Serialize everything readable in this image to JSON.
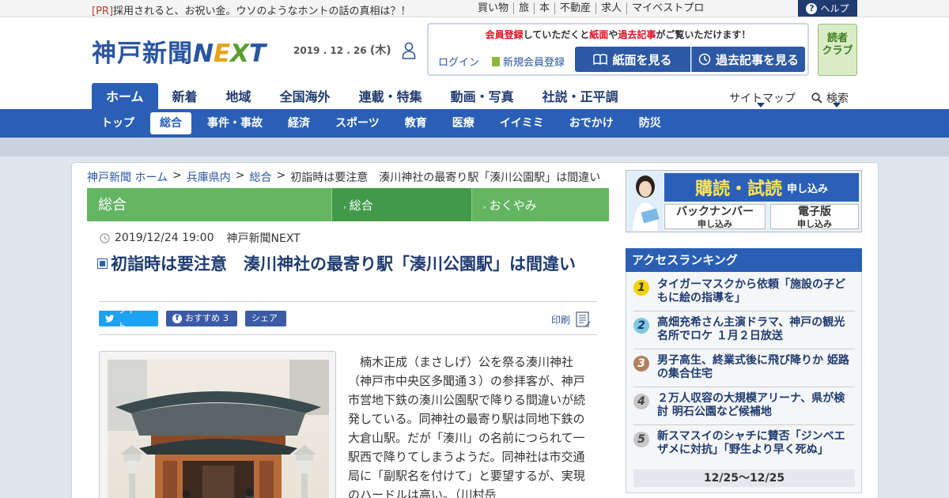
{
  "top": {
    "pr_tag": "[PR]",
    "pr_text": "採用されると、お祝い金。ウソのようなホントの話の真相は？！",
    "links": [
      "買い物",
      "旅",
      "本",
      "不動産",
      "求人",
      "マイベストプロ"
    ],
    "help": "ヘルプ"
  },
  "header": {
    "logo_text": "神戸新聞",
    "logo_next": [
      "N",
      "E",
      "X",
      "T"
    ],
    "date": "2019 . 12 . 26",
    "weekday": "(木)",
    "member_text_parts": [
      "会員登録",
      "していただくと",
      "紙面",
      "や",
      "過去記事",
      "がご覧いただけます！"
    ],
    "login": "ログイン",
    "register": "新規会員登録",
    "paper_button": "紙面を見る",
    "past_button": "過去記事を見る",
    "readers_club": [
      "読者",
      "クラブ"
    ]
  },
  "nav": {
    "main": [
      "ホーム",
      "新着",
      "地域",
      "全国海外",
      "連載・特集",
      "動画・写真",
      "社説・正平調"
    ],
    "sitemap": "サイトマップ",
    "search": "検索",
    "sub": [
      "トップ",
      "総合",
      "事件・事故",
      "経済",
      "スポーツ",
      "教育",
      "医療",
      "イイミミ",
      "おでかけ",
      "防災"
    ]
  },
  "breadcrumb": [
    "神戸新聞 ホーム",
    "兵庫県内",
    "総合",
    "初詣時は要注意　湊川神社の最寄り駅「湊川公園駅」は間違い"
  ],
  "section": {
    "title": "総合",
    "tabs": [
      "総合",
      "おくやみ"
    ]
  },
  "article": {
    "datetime": "2019/12/24 19:00",
    "source": "神戸新聞NEXT",
    "headline": "初詣時は要注意　湊川神社の最寄り駅「湊川公園駅」は間違い",
    "tweet": "ツイート",
    "recommend": "おすすめ",
    "recommend_count": "3",
    "share": "シェア",
    "print": "印刷",
    "body": "楠木正成（まさしげ）公を祭る湊川神社（神戸市中央区多聞通３）の参拝客が、神戸市営地下鉄の湊川公園駅で降りる間違いが続発している。同神社の最寄り駅は同地下鉄の大倉山駅。だが「湊川」の名前につられて一駅西で降りてしまうようだ。同神社は市交通局に「副駅名を付けて」と要望するが、実現のハードルは高い。（川村岳"
  },
  "ad": {
    "top": "購読・試読",
    "top_small": "申し込み",
    "back": "バックナンバー",
    "back_small": "申し込み",
    "digital": "電子版",
    "digital_small": "申し込み"
  },
  "ranking": {
    "title": "アクセスランキング",
    "items": [
      {
        "n": "1",
        "text": "タイガーマスクから依頼「施設の子どもに絵の指導を」"
      },
      {
        "n": "2",
        "text": "高畑充希さん主演ドラマ、神戸の観光名所でロケ １月２日放送"
      },
      {
        "n": "3",
        "text": "男子高生、終業式後に飛び降りか 姫路の集合住宅"
      },
      {
        "n": "4",
        "text": "２万人収容の大規模アリーナ、県が検討 明石公園など候補地"
      },
      {
        "n": "5",
        "text": "新スマスイのシャチに賛否「ジンベエザメに対抗」「野生より早く死ぬ」"
      }
    ],
    "period": "12/25～12/25"
  }
}
